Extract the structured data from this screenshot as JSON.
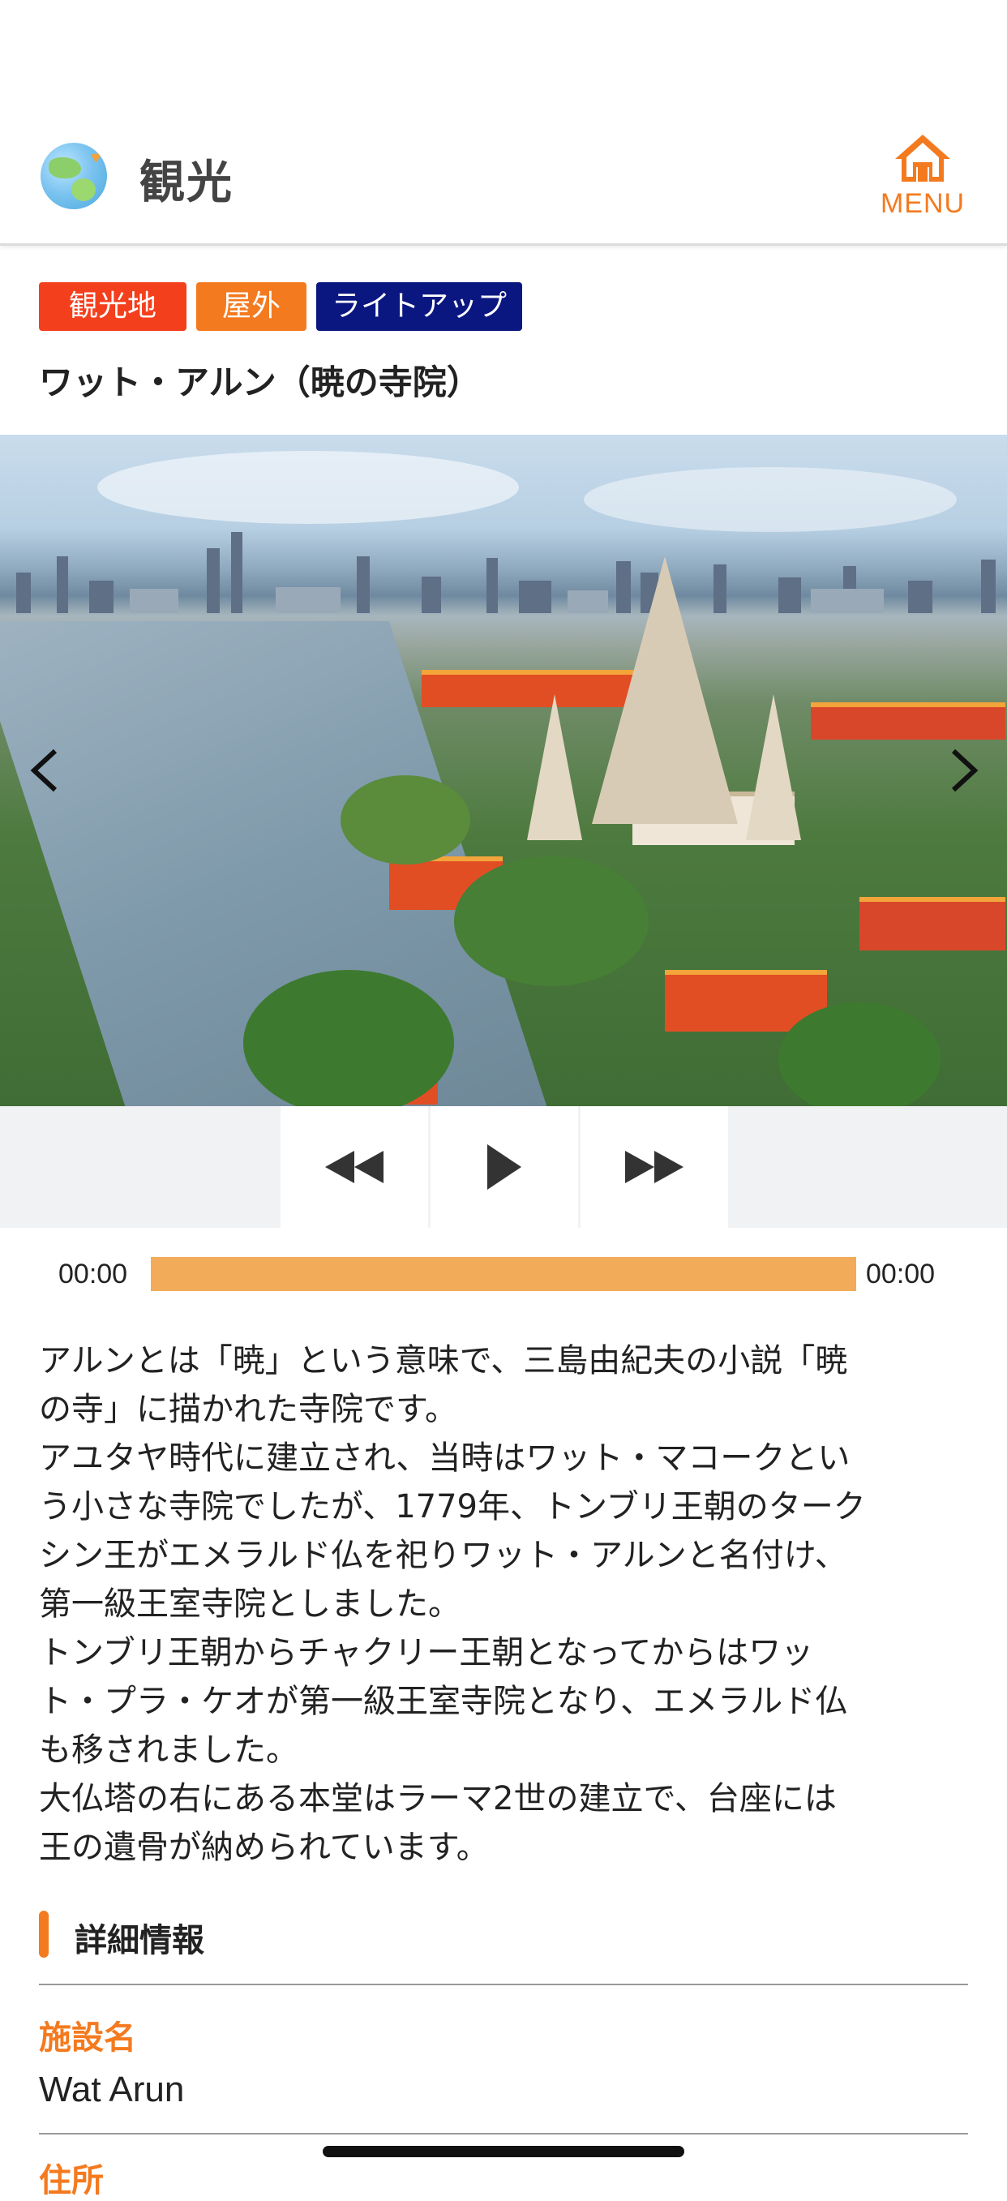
{
  "header": {
    "title": "観光",
    "menu_label": "MENU",
    "icons": {
      "logo": "globe-plane-icon",
      "menu": "home-icon"
    }
  },
  "tags": [
    "観光地",
    "屋外",
    "ライトアップ"
  ],
  "tag_colors": [
    "#f43f1d",
    "#f47a1f",
    "#0b1780"
  ],
  "spot": {
    "title": "ワット・アルン（暁の寺院）"
  },
  "gallery": {
    "icons": {
      "prev": "chevron-left-icon",
      "next": "chevron-right-icon"
    }
  },
  "player": {
    "icons": {
      "rewind": "rewind-icon",
      "play": "play-icon",
      "forward": "fast-forward-icon"
    },
    "time_start": "00:00",
    "time_end": "00:00"
  },
  "description": "アルンとは「暁」という意味で、三島由紀夫の小説「暁\nの寺」に描かれた寺院です。\nアユタヤ時代に建立され、当時はワット・マコークとい\nう小さな寺院でしたが、1779年、トンブリ王朝のターク\nシン王がエメラルド仏を祀りワット・アルンと名付け、\n第一級王室寺院としました。\nトンブリ王朝からチャクリー王朝となってからはワッ\nト・プラ・ケオが第一級王室寺院となり、エメラルド仏\nも移されました。\n大仏塔の右にある本堂はラーマ2世の建立で、台座には\n王の遺骨が納められています。",
  "details": {
    "heading": "詳細情報",
    "facility_label": "施設名",
    "facility_value": "Wat Arun",
    "address_label": "住所"
  },
  "colors": {
    "accent": "#f47a1f",
    "progress": "#f2ab58"
  }
}
